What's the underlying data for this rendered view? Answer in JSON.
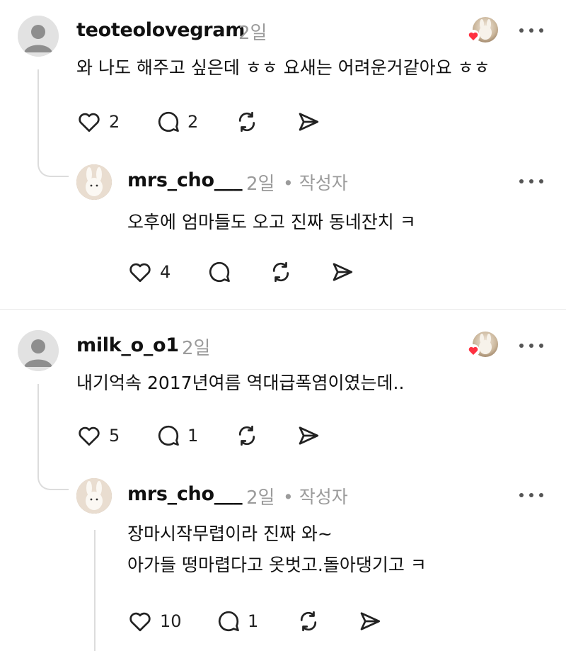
{
  "comments": [
    {
      "username": "teoteolovegram",
      "time": "2일",
      "text": "와 나도 해주고 싶은데 ㅎㅎ 요새는 어려운거같아요 ㅎㅎ",
      "likes": "2",
      "replies": "2",
      "liked_by_author": true,
      "reply": {
        "username": "mrs_cho___",
        "time": "2일",
        "author_tag": "• 작성자",
        "text_lines": [
          "오후에 엄마들도 오고 진짜 동네잔치 ㅋ"
        ],
        "likes": "4",
        "replies": ""
      }
    },
    {
      "username": "milk_o_o1",
      "time": "2일",
      "text": "내기억속 2017년여름 역대급폭염이였는데..",
      "likes": "5",
      "replies": "1",
      "liked_by_author": true,
      "reply": {
        "username": "mrs_cho___",
        "time": "2일",
        "author_tag": "• 작성자",
        "text_lines": [
          "장마시작무렵이라 진짜 와~",
          "아가들 떵마렵다고 옷벗고.돌아댕기고 ㅋ"
        ],
        "likes": "10",
        "replies": "1"
      }
    }
  ],
  "icons": {
    "like": "heart-outline-icon",
    "comment": "comment-bubble-icon",
    "repost": "repost-icon",
    "share": "send-icon",
    "more": "more-horizontal-icon"
  },
  "colors": {
    "heart_badge": "#ff3040",
    "muted_text": "#9b9b9b"
  }
}
